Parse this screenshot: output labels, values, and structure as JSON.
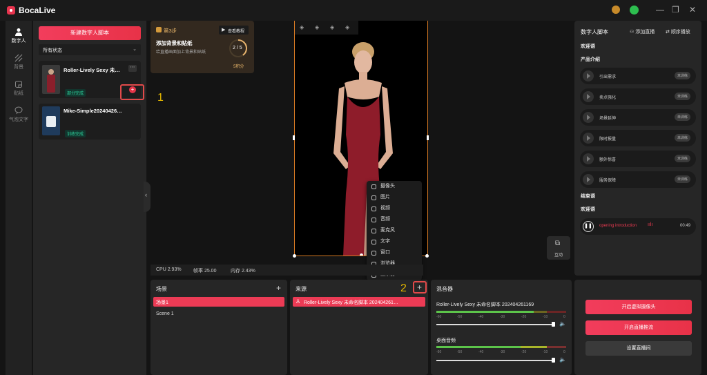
{
  "app": {
    "title": "BocaLive"
  },
  "nav": [
    {
      "label": "数字人",
      "icon": "person-icon"
    },
    {
      "label": "背景",
      "icon": "background-icon"
    },
    {
      "label": "贴纸",
      "icon": "sticker-icon"
    },
    {
      "label": "气泡文字",
      "icon": "bubble-text-icon"
    }
  ],
  "scripts": {
    "new_button": "新建数字人脚本",
    "filter": "所有状态",
    "items": [
      {
        "title": "Roller-Lively Sexy 未…",
        "status": "部分完成"
      },
      {
        "title": "Mike-Simple20240426…",
        "status": "训练完成"
      }
    ]
  },
  "annotations": {
    "one": "1",
    "two": "2"
  },
  "tutorial": {
    "step": "第3步",
    "watch": "查看教程",
    "title": "添加背景和贴纸",
    "desc": "给直播画面加上背景和贴纸",
    "progress": "2 / 5",
    "points": "5积分"
  },
  "preview_action": {
    "label": "互动"
  },
  "context_menu": [
    "摄像头",
    "图片",
    "视频",
    "音频",
    "麦克风",
    "文字",
    "窗口",
    "浏览器",
    "显示器"
  ],
  "stats": {
    "cpu": "CPU 2.93%",
    "fps": "帧率 25.00",
    "mem": "内存 2.43%"
  },
  "scenes": {
    "title": "场景",
    "items": [
      "场景1",
      "Scene 1"
    ]
  },
  "sources": {
    "title": "来源",
    "items": [
      "Roller-Lively Sexy 未命名脚本 202404261…"
    ]
  },
  "mixer": {
    "title": "混音器",
    "channels": [
      {
        "name": "Roller-Lively Sexy 未命名脚本 202404261169",
        "level": 0.75,
        "volume": 1.0
      },
      {
        "name": "桌面音频",
        "level": 0.0,
        "volume": 1.0
      }
    ],
    "ticks": [
      "-60",
      "-50",
      "-40",
      "-30",
      "-20",
      "-10",
      "0"
    ]
  },
  "right": {
    "title": "数字人脚本",
    "add_live": "添加直播",
    "order_play": "顺序播放",
    "welcome": "欢迎语",
    "product": "产品介绍",
    "items": [
      {
        "label": "引出需求",
        "status": "未训练"
      },
      {
        "label": "卖点强化",
        "status": "未训练"
      },
      {
        "label": "场景延伸",
        "status": "未训练"
      },
      {
        "label": "限时报量",
        "status": "未训练"
      },
      {
        "label": "额外惊喜",
        "status": "未训练"
      },
      {
        "label": "服务保障",
        "status": "未训练"
      }
    ],
    "ending": "结束语",
    "welcome2": "欢迎语",
    "playing": {
      "label": "opening introduction",
      "time": "00:49"
    }
  },
  "controls": {
    "camera": "开启虚拟摄像头",
    "stream": "开启直播推流",
    "settings": "设置直播间"
  },
  "colors": {
    "accent": "#ec3b55",
    "bg": "#141414",
    "panel": "#262626"
  }
}
